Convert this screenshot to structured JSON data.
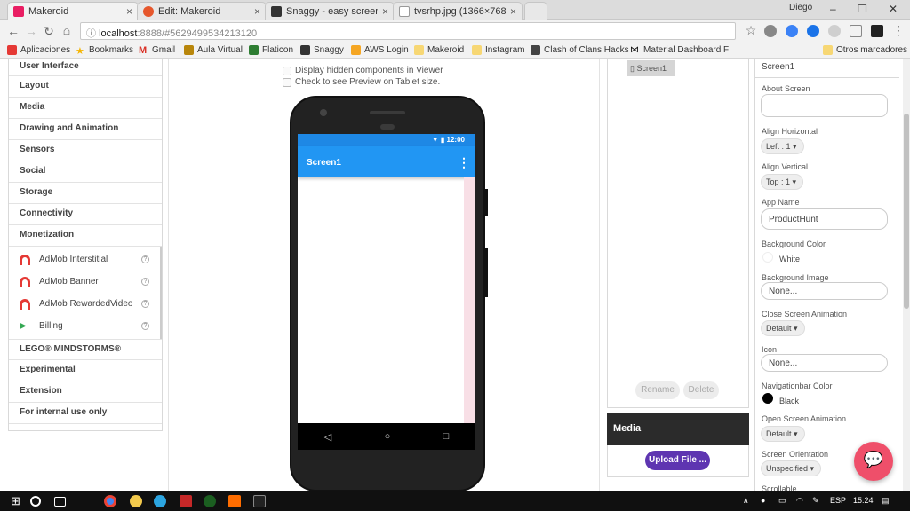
{
  "browser": {
    "tabs": [
      {
        "title": "Makeroid",
        "favicon_color": "#e91e63"
      },
      {
        "title": "Edit: Makeroid",
        "favicon_color": "#e6572c"
      },
      {
        "title": "Snaggy - easy screensho",
        "favicon_color": "#333333"
      },
      {
        "title": "tvsrhp.jpg (1366×768)",
        "favicon_color": "#777777"
      }
    ],
    "user": "Diego",
    "url_host": "localhost",
    "url_rest": ":8888/#5629499534213120",
    "bookmarks": [
      "Aplicaciones",
      "Bookmarks",
      "Gmail",
      "Aula Virtual",
      "Flaticon",
      "Snaggy",
      "AWS Login",
      "Makeroid",
      "Instagram",
      "Clash of Clans Hacks",
      "Material Dashboard F"
    ],
    "other_bookmarks": "Otros marcadores"
  },
  "palette": {
    "categories_top": [
      "User Interface",
      "Layout",
      "Media",
      "Drawing and Animation",
      "Sensors",
      "Social",
      "Storage",
      "Connectivity",
      "Monetization"
    ],
    "monetization_items": [
      "AdMob Interstitial",
      "AdMob Banner",
      "AdMob RewardedVideo",
      "Billing"
    ],
    "categories_bottom": [
      "LEGO® MINDSTORMS®",
      "Experimental",
      "Extension",
      "For internal use only"
    ]
  },
  "viewer": {
    "hidden_components_label": "Display hidden components in Viewer",
    "tablet_label": "Check to see Preview on Tablet size.",
    "status_time": "12:00",
    "screen_title": "Screen1",
    "accent_color": "#2196f3"
  },
  "components": {
    "root": "Screen1",
    "rename_label": "Rename",
    "delete_label": "Delete"
  },
  "media": {
    "title": "Media",
    "upload_label": "Upload File ..."
  },
  "properties": {
    "header": "Screen1",
    "about_screen_label": "About Screen",
    "align_horizontal_label": "Align Horizontal",
    "align_horizontal_value": "Left : 1",
    "align_vertical_label": "Align Vertical",
    "align_vertical_value": "Top : 1",
    "app_name_label": "App Name",
    "app_name_value": "ProductHunt",
    "background_color_label": "Background Color",
    "background_color_value": "White",
    "background_image_label": "Background Image",
    "background_image_value": "None...",
    "close_anim_label": "Close Screen Animation",
    "close_anim_value": "Default",
    "icon_label": "Icon",
    "icon_value": "None...",
    "navbar_color_label": "Navigationbar Color",
    "navbar_color_value": "Black",
    "open_anim_label": "Open Screen Animation",
    "open_anim_value": "Default",
    "orientation_label": "Screen Orientation",
    "orientation_value": "Unspecified",
    "scrollable_label": "Scrollable"
  },
  "taskbar": {
    "language": "ESP",
    "time": "15:24"
  }
}
